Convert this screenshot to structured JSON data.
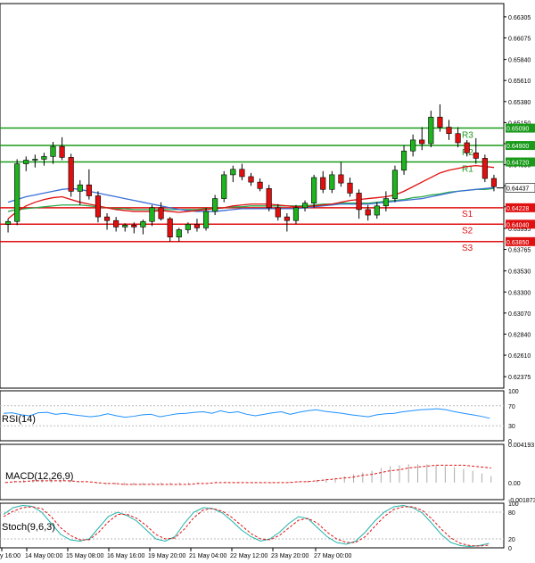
{
  "chart_data": {
    "type": "candlestick",
    "main": {
      "ylim": [
        0.6225,
        0.6645
      ],
      "y_ticks": [
        "0.66305",
        "0.66075",
        "0.65840",
        "0.65610",
        "0.65380",
        "0.65150",
        "0.64920",
        "0.64690",
        "0.64460",
        "0.64230",
        "0.63995",
        "0.63765",
        "0.63530",
        "0.63300",
        "0.63070",
        "0.62840",
        "0.62610",
        "0.62375"
      ],
      "levels": [
        {
          "name": "R3",
          "value": 0.6509,
          "label": "0.65090",
          "color": "#1a9a1a"
        },
        {
          "name": "R2",
          "value": 0.649,
          "label": "0.64900",
          "color": "#1a9a1a"
        },
        {
          "name": "R1",
          "value": 0.6472,
          "label": "0.64720",
          "color": "#1a9a1a"
        },
        {
          "name": "S1",
          "value": 0.6422,
          "label": "0.64228",
          "color": "#e01010"
        },
        {
          "name": "S2",
          "value": 0.6404,
          "label": "0.64040",
          "color": "#e01010"
        },
        {
          "name": "S3",
          "value": 0.6385,
          "label": "0.63850",
          "color": "#e01010"
        }
      ],
      "current": {
        "value": 0.64437,
        "label": "0.64437"
      },
      "candles": [
        [
          0.6404,
          0.641,
          0.6395,
          0.6407
        ],
        [
          0.6407,
          0.6475,
          0.6403,
          0.647
        ],
        [
          0.647,
          0.6478,
          0.6462,
          0.6474
        ],
        [
          0.6474,
          0.648,
          0.6466,
          0.6475
        ],
        [
          0.6475,
          0.6482,
          0.6468,
          0.6478
        ],
        [
          0.6478,
          0.6494,
          0.647,
          0.6489
        ],
        [
          0.6489,
          0.6499,
          0.6474,
          0.6477
        ],
        [
          0.6477,
          0.6481,
          0.6434,
          0.644
        ],
        [
          0.644,
          0.6452,
          0.6425,
          0.6447
        ],
        [
          0.6447,
          0.6464,
          0.6431,
          0.6435
        ],
        [
          0.6435,
          0.644,
          0.6406,
          0.6412
        ],
        [
          0.6412,
          0.6416,
          0.6398,
          0.6408
        ],
        [
          0.6408,
          0.6412,
          0.6396,
          0.6401
        ],
        [
          0.6401,
          0.6405,
          0.6396,
          0.6403
        ],
        [
          0.6403,
          0.6406,
          0.6394,
          0.6401
        ],
        [
          0.6401,
          0.6409,
          0.6393,
          0.6407
        ],
        [
          0.6407,
          0.6425,
          0.6402,
          0.6422
        ],
        [
          0.6422,
          0.6428,
          0.6408,
          0.641
        ],
        [
          0.641,
          0.6412,
          0.6385,
          0.639
        ],
        [
          0.639,
          0.64,
          0.6385,
          0.6398
        ],
        [
          0.6398,
          0.6406,
          0.6394,
          0.6404
        ],
        [
          0.6404,
          0.641,
          0.6396,
          0.64
        ],
        [
          0.64,
          0.6422,
          0.6397,
          0.6418
        ],
        [
          0.6418,
          0.6436,
          0.6414,
          0.6432
        ],
        [
          0.6432,
          0.6462,
          0.6428,
          0.6458
        ],
        [
          0.6458,
          0.6468,
          0.645,
          0.6464
        ],
        [
          0.6464,
          0.647,
          0.6452,
          0.6456
        ],
        [
          0.6456,
          0.646,
          0.6446,
          0.645
        ],
        [
          0.645,
          0.6454,
          0.644,
          0.6443
        ],
        [
          0.6443,
          0.6447,
          0.6418,
          0.6422
        ],
        [
          0.6422,
          0.6426,
          0.6408,
          0.6412
        ],
        [
          0.6412,
          0.6416,
          0.6396,
          0.6408
        ],
        [
          0.6408,
          0.6425,
          0.6404,
          0.6422
        ],
        [
          0.6422,
          0.643,
          0.6418,
          0.6427
        ],
        [
          0.6427,
          0.6458,
          0.6422,
          0.6455
        ],
        [
          0.6455,
          0.6462,
          0.6438,
          0.6442
        ],
        [
          0.6442,
          0.6462,
          0.6438,
          0.6458
        ],
        [
          0.6458,
          0.6472,
          0.6445,
          0.6449
        ],
        [
          0.6449,
          0.6455,
          0.6434,
          0.6438
        ],
        [
          0.6438,
          0.6442,
          0.641,
          0.642
        ],
        [
          0.642,
          0.6425,
          0.6408,
          0.6414
        ],
        [
          0.6414,
          0.6428,
          0.641,
          0.6424
        ],
        [
          0.6424,
          0.644,
          0.6418,
          0.6432
        ],
        [
          0.6432,
          0.6468,
          0.6428,
          0.6463
        ],
        [
          0.6463,
          0.649,
          0.6458,
          0.6484
        ],
        [
          0.6484,
          0.6502,
          0.6478,
          0.6496
        ],
        [
          0.6496,
          0.651,
          0.6485,
          0.6492
        ],
        [
          0.6492,
          0.6528,
          0.6488,
          0.6521
        ],
        [
          0.6521,
          0.6535,
          0.6505,
          0.651
        ],
        [
          0.651,
          0.6518,
          0.6496,
          0.6503
        ],
        [
          0.6503,
          0.651,
          0.6488,
          0.6493
        ],
        [
          0.6493,
          0.6496,
          0.6478,
          0.6482
        ],
        [
          0.6482,
          0.6498,
          0.647,
          0.6476
        ],
        [
          0.6476,
          0.648,
          0.645,
          0.6454
        ],
        [
          0.6454,
          0.6458,
          0.644,
          0.6445
        ]
      ],
      "ma_red": [
        0.641,
        0.6418,
        0.6424,
        0.6428,
        0.6431,
        0.6433,
        0.6434,
        0.6431,
        0.6428,
        0.6426,
        0.6424,
        0.6422,
        0.642,
        0.6419,
        0.6418,
        0.6418,
        0.6418,
        0.6419,
        0.6418,
        0.6417,
        0.6418,
        0.6419,
        0.642,
        0.6421,
        0.6422,
        0.6424,
        0.6425,
        0.6426,
        0.6426,
        0.6426,
        0.6425,
        0.6424,
        0.6423,
        0.6423,
        0.6424,
        0.6425,
        0.6426,
        0.6428,
        0.643,
        0.6431,
        0.6432,
        0.6433,
        0.6434,
        0.6436,
        0.644,
        0.6445,
        0.645,
        0.6455,
        0.646,
        0.6463,
        0.6465,
        0.6467,
        0.6468,
        0.6467,
        0.6466
      ],
      "ma_blue": [
        0.6428,
        0.6431,
        0.6434,
        0.6436,
        0.6438,
        0.644,
        0.6442,
        0.6443,
        0.6442,
        0.644,
        0.6438,
        0.6436,
        0.6434,
        0.6432,
        0.643,
        0.6428,
        0.6426,
        0.6424,
        0.6422,
        0.642,
        0.6419,
        0.6418,
        0.6418,
        0.6418,
        0.6419,
        0.642,
        0.6421,
        0.6421,
        0.6421,
        0.6421,
        0.6421,
        0.6421,
        0.6421,
        0.6422,
        0.6423,
        0.6424,
        0.6425,
        0.6426,
        0.6426,
        0.6426,
        0.6426,
        0.6427,
        0.6428,
        0.6429,
        0.643,
        0.6431,
        0.6432,
        0.6434,
        0.6436,
        0.6438,
        0.644,
        0.6441,
        0.6442,
        0.6443,
        0.6444
      ],
      "ma_green": [
        0.6418,
        0.642,
        0.6421,
        0.6422,
        0.6423,
        0.6424,
        0.6425,
        0.6425,
        0.6425,
        0.6424,
        0.6423,
        0.6422,
        0.6421,
        0.6421,
        0.642,
        0.642,
        0.642,
        0.642,
        0.642,
        0.642,
        0.642,
        0.642,
        0.6421,
        0.6421,
        0.6422,
        0.6423,
        0.6423,
        0.6424,
        0.6424,
        0.6424,
        0.6424,
        0.6424,
        0.6424,
        0.6424,
        0.6425,
        0.6426,
        0.6426,
        0.6427,
        0.6427,
        0.6427,
        0.6427,
        0.6428,
        0.6429,
        0.643,
        0.6431,
        0.6433,
        0.6434,
        0.6436,
        0.6437,
        0.6439,
        0.644,
        0.6441,
        0.6442,
        0.6442,
        0.6443
      ]
    },
    "x_labels": [
      "y 16:00",
      "14 May 00:00",
      "15 May 08:00",
      "16 May 16:00",
      "19 May 20:00",
      "21 May 04:00",
      "22 May 12:00",
      "23 May 20:00",
      "27 May 00:00"
    ],
    "rsi": {
      "label": "RSI(14)",
      "ylim": [
        0,
        100
      ],
      "ticks": [
        "100",
        "70",
        "30",
        "0"
      ],
      "values": [
        55,
        56,
        52,
        50,
        56,
        57,
        53,
        55,
        52,
        50,
        48,
        50,
        54,
        50,
        47,
        49,
        52,
        53,
        48,
        51,
        54,
        55,
        57,
        58,
        55,
        60,
        56,
        58,
        53,
        50,
        53,
        56,
        58,
        53,
        57,
        60,
        62,
        59,
        57,
        55,
        52,
        50,
        48,
        52,
        54,
        55,
        58,
        60,
        62,
        63,
        64,
        62,
        58,
        55,
        52,
        49,
        45
      ]
    },
    "macd": {
      "label": "MACD(12,26,9)",
      "ylim": [
        -0.00187,
        0.00419
      ],
      "ticks": [
        "0.004193",
        "0.00",
        "-0.001873"
      ],
      "hist": [
        0.0001,
        0.0002,
        0.0003,
        0.0003,
        0.0004,
        0.0004,
        0.0003,
        0.0002,
        0.0001,
        0.0,
        -0.0001,
        -0.0002,
        -0.0002,
        -0.0003,
        -0.0003,
        -0.0003,
        -0.0002,
        -0.0003,
        -0.0003,
        -0.0002,
        -0.0002,
        -0.0001,
        0.0,
        0.0001,
        0.0001,
        0.0,
        0.0,
        -0.0001,
        -0.0001,
        -0.0001,
        0.0,
        0.0001,
        0.0001,
        0.0002,
        0.0003,
        0.0004,
        0.0005,
        0.0007,
        0.0009,
        0.0011,
        0.0013,
        0.0016,
        0.0018,
        0.0019,
        0.002,
        0.002,
        0.002,
        0.0019,
        0.0018,
        0.0017,
        0.0015,
        0.0013,
        0.001,
        0.0007
      ],
      "signal": [
        0.0,
        0.0001,
        0.0001,
        0.0002,
        0.0002,
        0.0002,
        0.0002,
        0.0002,
        0.0001,
        0.0001,
        0.0,
        -0.0001,
        -0.0001,
        -0.0002,
        -0.0002,
        -0.0002,
        -0.0002,
        -0.0002,
        -0.0002,
        -0.0002,
        -0.0002,
        -0.0001,
        -0.0001,
        0.0,
        0.0,
        0.0,
        0.0,
        0.0,
        0.0,
        0.0,
        0.0,
        0.0,
        0.0001,
        0.0001,
        0.0002,
        0.0003,
        0.0004,
        0.0005,
        0.0006,
        0.0008,
        0.0009,
        0.0011,
        0.0013,
        0.0014,
        0.0016,
        0.0017,
        0.0018,
        0.0019,
        0.0019,
        0.0019,
        0.0019,
        0.0018,
        0.0017,
        0.0016
      ]
    },
    "stoch": {
      "label": "Stoch(9,6,3)",
      "ylim": [
        0,
        100
      ],
      "ticks": [
        "100",
        "80",
        "20",
        "0"
      ],
      "k": [
        75,
        90,
        95,
        93,
        80,
        55,
        30,
        18,
        15,
        20,
        45,
        70,
        80,
        72,
        60,
        40,
        20,
        15,
        25,
        55,
        80,
        90,
        88,
        78,
        60,
        40,
        25,
        15,
        20,
        35,
        55,
        70,
        65,
        45,
        25,
        12,
        8,
        15,
        35,
        60,
        80,
        92,
        95,
        90,
        78,
        55,
        30,
        12,
        5,
        3,
        5,
        10
      ],
      "d": [
        70,
        82,
        90,
        92,
        88,
        70,
        45,
        28,
        18,
        18,
        35,
        58,
        75,
        75,
        66,
        50,
        30,
        20,
        22,
        42,
        68,
        85,
        88,
        82,
        68,
        50,
        32,
        20,
        18,
        28,
        45,
        62,
        66,
        55,
        35,
        20,
        12,
        12,
        25,
        48,
        70,
        86,
        92,
        92,
        84,
        65,
        42,
        22,
        10,
        5,
        4,
        6
      ]
    }
  }
}
